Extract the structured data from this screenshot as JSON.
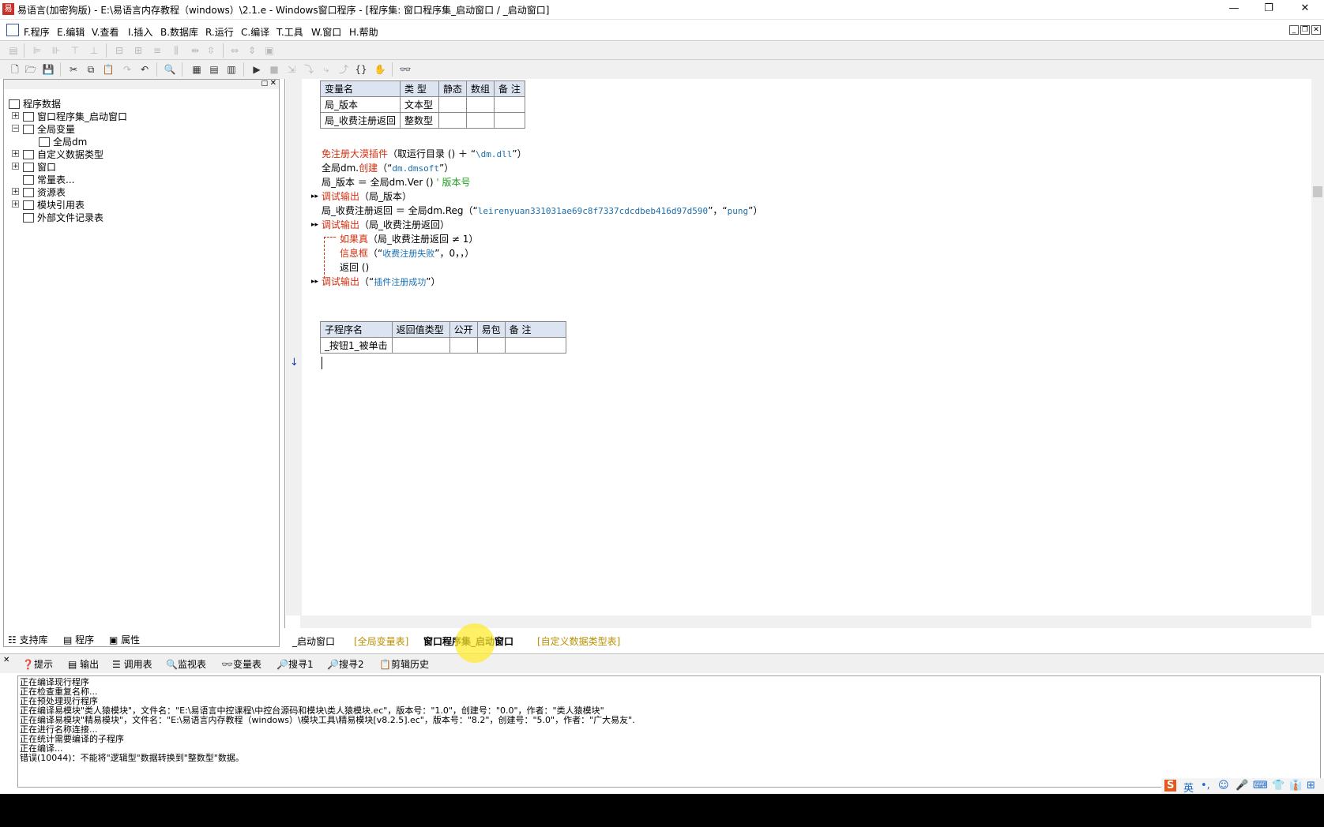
{
  "window": {
    "title": "易语言(加密狗版) - E:\\易语言内存教程（windows）\\2.1.e - Windows窗口程序 - [程序集: 窗口程序集_启动窗口 / _启动窗口]",
    "minimize": "—",
    "restore": "❐",
    "close": "✕"
  },
  "menu": {
    "items": [
      "F.程序",
      "E.编辑",
      "V.查看",
      "I.插入",
      "B.数据库",
      "R.运行",
      "C.编译",
      "T.工具",
      "W.窗口",
      "H.帮助"
    ],
    "mdi_min": "_",
    "mdi_restore": "❐",
    "mdi_close": "✕"
  },
  "tree": {
    "root": "程序数据",
    "items": [
      {
        "label": "窗口程序集_启动窗口",
        "exp": "+"
      },
      {
        "label": "全局变量",
        "exp": "−"
      },
      {
        "label": "全局dm",
        "exp": ""
      },
      {
        "label": "自定义数据类型",
        "exp": "+"
      },
      {
        "label": "窗口",
        "exp": "+"
      },
      {
        "label": "常量表...",
        "exp": ""
      },
      {
        "label": "资源表",
        "exp": "+"
      },
      {
        "label": "模块引用表",
        "exp": "+"
      },
      {
        "label": "外部文件记录表",
        "exp": ""
      }
    ]
  },
  "left_tabs": [
    "支持库",
    "程序",
    "属性"
  ],
  "var_table": {
    "headers": [
      "变量名",
      "类 型",
      "静态",
      "数组",
      "备 注"
    ],
    "rows": [
      [
        "局_版本",
        "文本型",
        "",
        "",
        ""
      ],
      [
        "局_收费注册返回",
        "整数型",
        "",
        "",
        ""
      ]
    ]
  },
  "code": {
    "l1_kw": "免注册大漠插件",
    "l1_rest": "（取运行目录 () ＋ “",
    "l1_str": "\\dm.dll",
    "l1_end": "”）",
    "l2_a": "全局dm.",
    "l2_kw": "创建",
    "l2_b": "（“",
    "l2_str": "dm.dmsoft",
    "l2_c": "”）",
    "l3_a": "局_版本 ＝ 全局dm.Ver ()",
    "l3_cmt": "' 版本号",
    "l4_kw": "调试输出",
    "l4_rest": "（局_版本）",
    "l5_a": "局_收费注册返回 ＝ 全局dm.Reg（“",
    "l5_str1": "leirenyuan331031ae69c8f7337cdcdbeb416d97d590",
    "l5_b": "”，“",
    "l5_str2": "pung",
    "l5_c": "”）",
    "l6_kw": "调试输出",
    "l6_rest": "（局_收费注册返回）",
    "l7_kw": "如果真",
    "l7_rest": "（局_收费注册返回 ≠ 1）",
    "l8_kw": "信息框",
    "l8_b": "（“",
    "l8_str": "收费注册失败",
    "l8_c": "”，0，，）",
    "l9_kw": "返回",
    "l9_rest": " ()",
    "l10_kw": "调试输出",
    "l10_b": "（“",
    "l10_str": "插件注册成功",
    "l10_c": "”）",
    "arrow": "▸▸",
    "down_arrow": "↓"
  },
  "sub_table": {
    "headers": [
      "子程序名",
      "返回值类型",
      "公开",
      "易包",
      "备 注"
    ],
    "rows": [
      [
        "_按钮1_被单击",
        "",
        "",
        "",
        ""
      ]
    ]
  },
  "editor_tabs": [
    "_启动窗口",
    "[全局变量表]",
    "窗口程序集_启动窗口",
    "[自定义数据类型表]"
  ],
  "output_tabs": [
    "提示",
    "输出",
    "调用表",
    "监视表",
    "变量表",
    "搜寻1",
    "搜寻2",
    "剪辑历史"
  ],
  "output_lines": [
    "正在编译现行程序",
    "正在检查重复名称...",
    "正在预处理现行程序",
    "正在编译易模块\"类人猿模块\"，文件名：\"E:\\易语言中控课程\\中控台源码和模块\\类人猿模块.ec\"，版本号：\"1.0\"，创建号：\"0.0\"，作者：\"类人猿模块\"",
    "正在编译易模块\"精易模块\"，文件名：\"E:\\易语言内存教程（windows）\\模块工具\\精易模块[v8.2.5].ec\"，版本号：\"8.2\"，创建号：\"5.0\"，作者：\"广大易友\".",
    "正在进行名称连接...",
    "正在统计需要编译的子程序",
    "正在编译...",
    "错误(10044)：不能将\"逻辑型\"数据转换到\"整数型\"数据。"
  ],
  "ime": [
    "S",
    "英",
    "•,",
    "☺",
    "🎤",
    "⌨",
    "👕",
    "👔",
    "⊞"
  ]
}
